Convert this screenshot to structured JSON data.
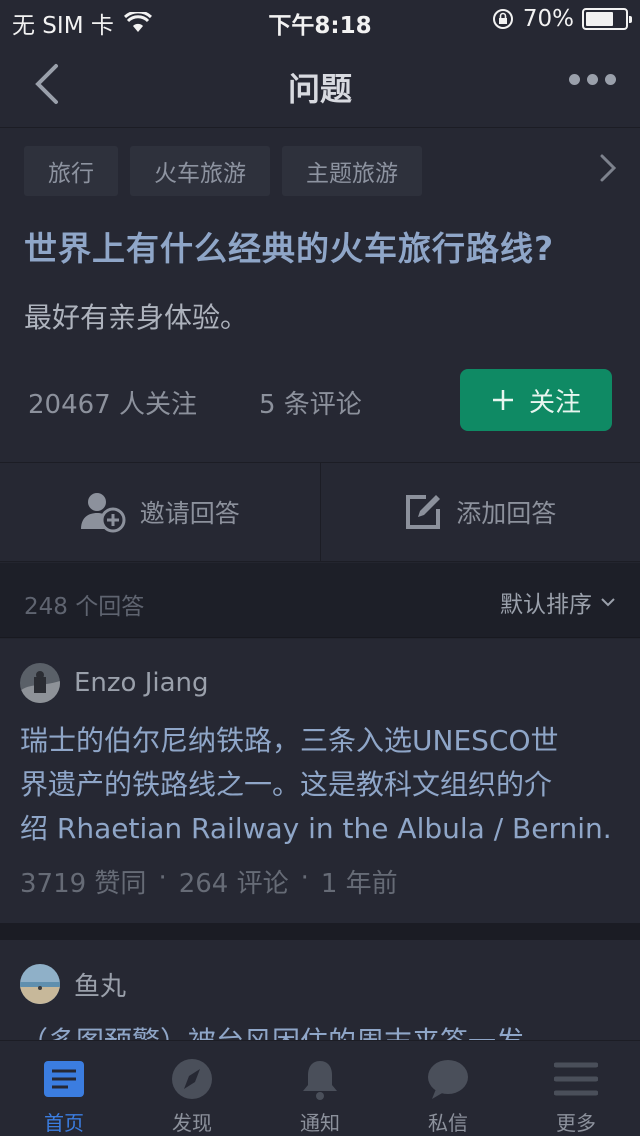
{
  "status_bar": {
    "carrier": "无 SIM 卡",
    "time": "下午8:18",
    "battery": "70%",
    "battery_level": 0.7
  },
  "nav": {
    "title": "问题"
  },
  "question": {
    "tags": [
      "旅行",
      "火车旅游",
      "主题旅游"
    ],
    "title": "世界上有什么经典的火车旅行路线?",
    "description": "最好有亲身体验。",
    "followers": "20467 人关注",
    "comments": "5 条评论",
    "follow_label": "关注"
  },
  "actions": {
    "invite_label": "邀请回答",
    "add_label": "添加回答"
  },
  "answers_header": {
    "count": "248 个回答",
    "sort": "默认排序"
  },
  "answers": [
    {
      "author": "Enzo Jiang",
      "lines": [
        "瑞士的伯尔尼纳铁路，三条入选UNESCO世",
        "界遗产的铁路线之一。这是教科文组织的介",
        "绍 Rhaetian Railway in the Albula / Bernin..."
      ],
      "likes": "3719 赞同",
      "comments": "264 评论",
      "time": "1 年前"
    },
    {
      "author": "鱼丸",
      "lines": [
        "（多图预警）被台风困住的周末来答一发"
      ]
    }
  ],
  "tabbar": {
    "items": [
      "首页",
      "发现",
      "通知",
      "私信",
      "更多"
    ],
    "active_color": "#3b7de0"
  },
  "colors": {
    "accent_green": "#0f8a64",
    "title_blue": "#8fa6c8",
    "background": "#23252f"
  }
}
